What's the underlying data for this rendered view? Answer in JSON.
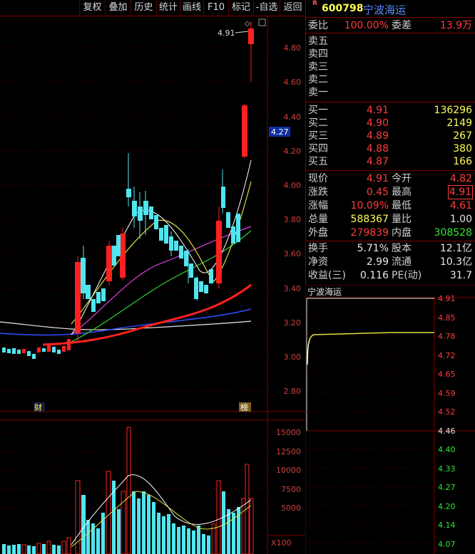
{
  "toolbar": {
    "items": [
      "复权",
      "叠加",
      "历史",
      "统计",
      "画线",
      "F10",
      "标记",
      "-自选",
      "返回"
    ]
  },
  "kline": {
    "price_axis": [
      "4.80",
      "4.60",
      "4.40",
      "4.20",
      "4.00",
      "3.80",
      "3.60",
      "3.40",
      "3.20",
      "3.00",
      "2.80"
    ],
    "current_price_tag": "4.27",
    "high_marker": "4.91",
    "event_marker_cai": "财",
    "event_marker_bang": "榜",
    "volume_axis": [
      "15000",
      "12500",
      "10000",
      "7500",
      "5000"
    ],
    "volume_unit": "X100"
  },
  "quote": {
    "r_badge": "R",
    "code": "600798",
    "name": "宁波海运",
    "weibi_label": "委比",
    "weibi": "100.00%",
    "weicha_label": "委差",
    "weicha": "13.9万",
    "sell": [
      {
        "label": "卖五",
        "price": "",
        "vol": ""
      },
      {
        "label": "卖四",
        "price": "",
        "vol": ""
      },
      {
        "label": "卖三",
        "price": "",
        "vol": ""
      },
      {
        "label": "卖二",
        "price": "",
        "vol": ""
      },
      {
        "label": "卖一",
        "price": "",
        "vol": ""
      }
    ],
    "buy": [
      {
        "label": "买一",
        "price": "4.91",
        "vol": "136296"
      },
      {
        "label": "买二",
        "price": "4.90",
        "vol": "2149"
      },
      {
        "label": "买三",
        "price": "4.89",
        "vol": "267"
      },
      {
        "label": "买四",
        "price": "4.88",
        "vol": "380"
      },
      {
        "label": "买五",
        "price": "4.87",
        "vol": "166"
      }
    ],
    "stats": [
      {
        "l1": "现价",
        "v1": "4.91",
        "c1": "red",
        "l2": "今开",
        "v2": "4.82",
        "c2": "red"
      },
      {
        "l1": "涨跌",
        "v1": "0.45",
        "c1": "red",
        "l2": "最高",
        "v2": "4.91",
        "c2": "red"
      },
      {
        "l1": "涨幅",
        "v1": "10.09%",
        "c1": "red",
        "l2": "最低",
        "v2": "4.61",
        "c2": "red"
      },
      {
        "l1": "总量",
        "v1": "588367",
        "c1": "yellow",
        "l2": "量比",
        "v2": "1.00",
        "c2": "white"
      },
      {
        "l1": "外盘",
        "v1": "279839",
        "c1": "red",
        "l2": "内盘",
        "v2": "308528",
        "c2": "green"
      }
    ],
    "fund": [
      {
        "l1": "换手",
        "v1": "5.71%",
        "l2": "股本",
        "v2": "12.1亿"
      },
      {
        "l1": "净资",
        "v1": "2.99",
        "l2": "流通",
        "v2": "10.3亿"
      },
      {
        "l1": "收益(三)",
        "v1": "0.116",
        "l2": "PE(动)",
        "v2": "31.7"
      }
    ]
  },
  "mini": {
    "title": "宁波海运",
    "upper_axis": [
      "4.91",
      "4.85",
      "4.78",
      "4.72",
      "4.65",
      "4.59",
      "4.52"
    ],
    "mid_axis": "4.46",
    "lower_axis": [
      "4.40",
      "4.33",
      "4.27",
      "4.20",
      "4.14",
      "4.07"
    ]
  },
  "colors": {
    "up": "#ff2020",
    "down": "#50e6f0",
    "frame": "#800000"
  }
}
